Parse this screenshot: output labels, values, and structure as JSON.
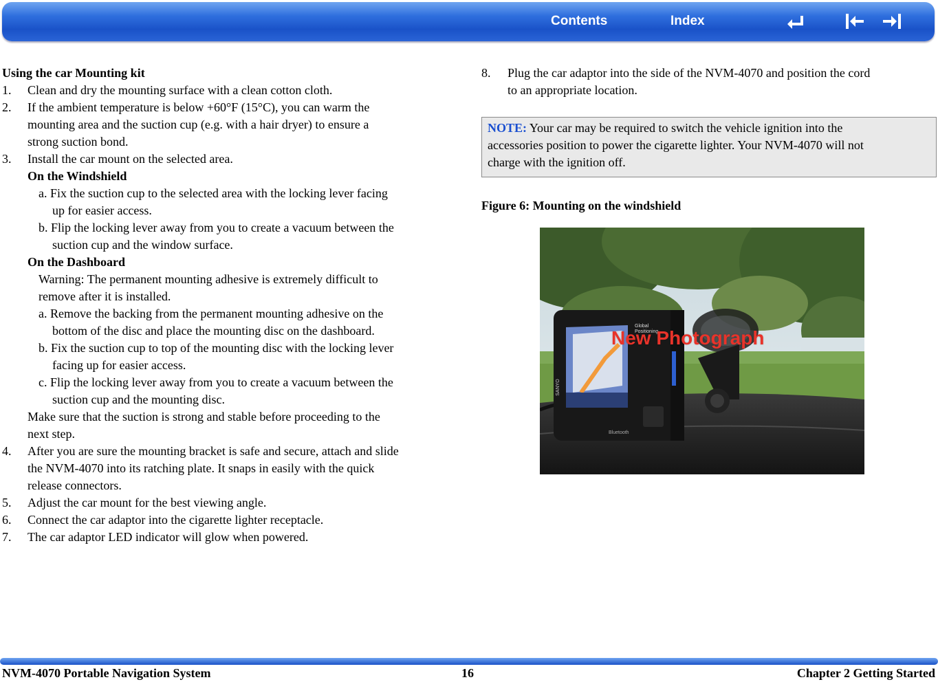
{
  "header": {
    "contents_label": "Contents",
    "index_label": "Index"
  },
  "icons": {
    "back": "back-icon",
    "previous": "previous-page-icon",
    "next": "next-page-icon"
  },
  "left": {
    "heading": "Using the car Mounting kit",
    "lines": [
      "Clean and dry the mounting surface with a clean cotton cloth.",
      "If the ambient temperature is below +60°F (15°C), you can warm the",
      "mounting area and the suction cup (e.g. with a hair dryer) to ensure a",
      "strong suction bond.",
      "Install the car mount on the selected area.",
      "On the Windshield",
      "a. Fix the suction cup to the selected area with the locking lever facing",
      "up for easier access.",
      "b. Flip the locking lever away from you to create a vacuum between the",
      "suction cup and the window surface.",
      "On the Dashboard",
      "Warning: The permanent mounting adhesive is extremely difficult to",
      "remove after it is installed.",
      "a. Remove the backing from the permanent mounting adhesive on the",
      "bottom of the disc and place the mounting disc on the dashboard.",
      "b. Fix the suction cup to top of the mounting disc with the locking lever",
      "facing up for easier access.",
      "c. Flip the locking lever away from you to create a vacuum between the",
      "suction cup and the mounting disc.",
      "Make sure that the suction is strong and stable before proceeding to the",
      "next step.",
      "After you are sure the mounting bracket is safe and secure, attach and slide",
      "the NVM-4070 into its ratching plate. It snaps in easily with the quick",
      "release connectors.",
      "Adjust the car mount for the best viewing angle.",
      "Connect the car adaptor into the cigarette lighter receptacle.",
      "The car adaptor LED indicator will glow when powered."
    ],
    "numbers": [
      "1.",
      "2.",
      "3.",
      "4.",
      "5.",
      "6.",
      "7."
    ]
  },
  "right": {
    "step8_number": "8.",
    "step8_line1": "Plug the car adaptor into the side of the NVM-4070 and position the cord",
    "step8_line2": "to an appropriate location.",
    "note_label": "NOTE:",
    "note_line1": " Your car may be required to switch the vehicle ignition into the",
    "note_line2": "accessories position to power the cigarette lighter. Your NVM-4070 will not",
    "note_line3": "charge with the ignition off.",
    "figure_caption": "Figure 6: Mounting on the windshield",
    "photo_overlay": "New Photograph",
    "device_brand": "SANYO",
    "device_label": "Global Positioning",
    "device_bottom": "Bluetooth"
  },
  "footer": {
    "left": "NVM-4070 Portable Navigation System",
    "page": "16",
    "right": "Chapter 2 Getting Started"
  },
  "colors": {
    "bar_blue": "#2f6fde",
    "note_label_blue": "#1a4fd0",
    "overlay_red": "#e8332a",
    "note_bg": "#e9e9e9"
  }
}
